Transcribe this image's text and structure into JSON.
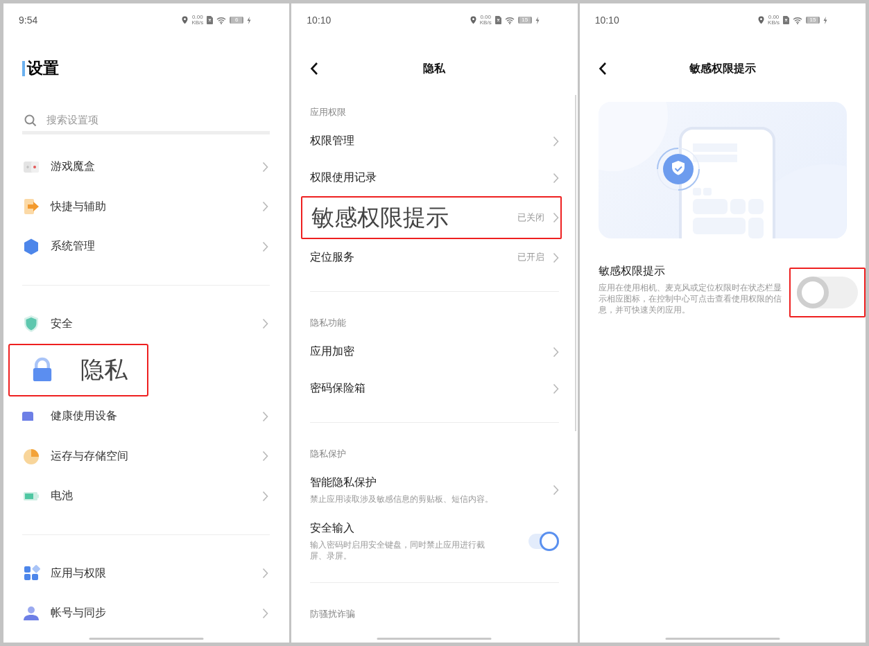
{
  "panels": [
    {
      "kind": "home",
      "status": {
        "time": "9:54",
        "speed": "0.00",
        "speed_unit": "KB/s",
        "battery": "6"
      },
      "title": "设置",
      "search": {
        "placeholder": "搜索设置项"
      },
      "groups": [
        [
          {
            "label": "游戏魔盒",
            "highlighted": false
          },
          {
            "label": "快捷与辅助",
            "highlighted": false
          },
          {
            "label": "系统管理",
            "highlighted": false
          }
        ],
        [
          {
            "label": "安全",
            "highlighted": false
          },
          {
            "label": "隐私",
            "highlighted": true
          },
          {
            "label": "健康使用设备",
            "highlighted": false
          },
          {
            "label": "运存与存储空间",
            "highlighted": false
          },
          {
            "label": "电池",
            "highlighted": false
          }
        ],
        [
          {
            "label": "应用与权限",
            "highlighted": false
          },
          {
            "label": "帐号与同步",
            "highlighted": false
          }
        ]
      ]
    },
    {
      "kind": "detail",
      "status": {
        "time": "10:10",
        "speed": "0.00",
        "speed_unit": "KB/s",
        "battery": "15"
      },
      "title": "隐私",
      "sections": [
        {
          "heading": "应用权限",
          "items": [
            {
              "kind": "link",
              "label": "权限管理",
              "highlighted": false
            },
            {
              "kind": "link",
              "label": "权限使用记录",
              "highlighted": false
            },
            {
              "kind": "link",
              "label": "敏感权限提示",
              "value": "已关闭",
              "highlighted": true
            },
            {
              "kind": "link",
              "label": "定位服务",
              "value": "已开启",
              "highlighted": false
            }
          ]
        },
        {
          "heading": "隐私功能",
          "items": [
            {
              "kind": "link",
              "label": "应用加密",
              "highlighted": false
            },
            {
              "kind": "link",
              "label": "密码保险箱",
              "highlighted": false
            }
          ]
        },
        {
          "heading": "隐私保护",
          "items": [
            {
              "kind": "link",
              "label": "智能隐私保护",
              "description": "禁止应用读取涉及敏感信息的剪贴板、短信内容。",
              "highlighted": false
            },
            {
              "kind": "toggle",
              "label": "安全输入",
              "description": "输入密码时启用安全键盘，同时禁止应用进行截屏、录屏。",
              "on": true,
              "highlighted": false
            }
          ]
        },
        {
          "heading": "防骚扰诈骗"
        }
      ]
    },
    {
      "kind": "toggle_page",
      "status": {
        "time": "10:10",
        "speed": "0.00",
        "speed_unit": "KB/s",
        "battery": "15"
      },
      "title": "敏感权限提示",
      "setting": {
        "label": "敏感权限提示",
        "description": "应用在使用相机、麦克风或定位权限时在状态栏显示相应图标，在控制中心可点击查看使用权限的信息，并可快速关闭应用。",
        "on": false,
        "highlighted": true
      }
    }
  ]
}
